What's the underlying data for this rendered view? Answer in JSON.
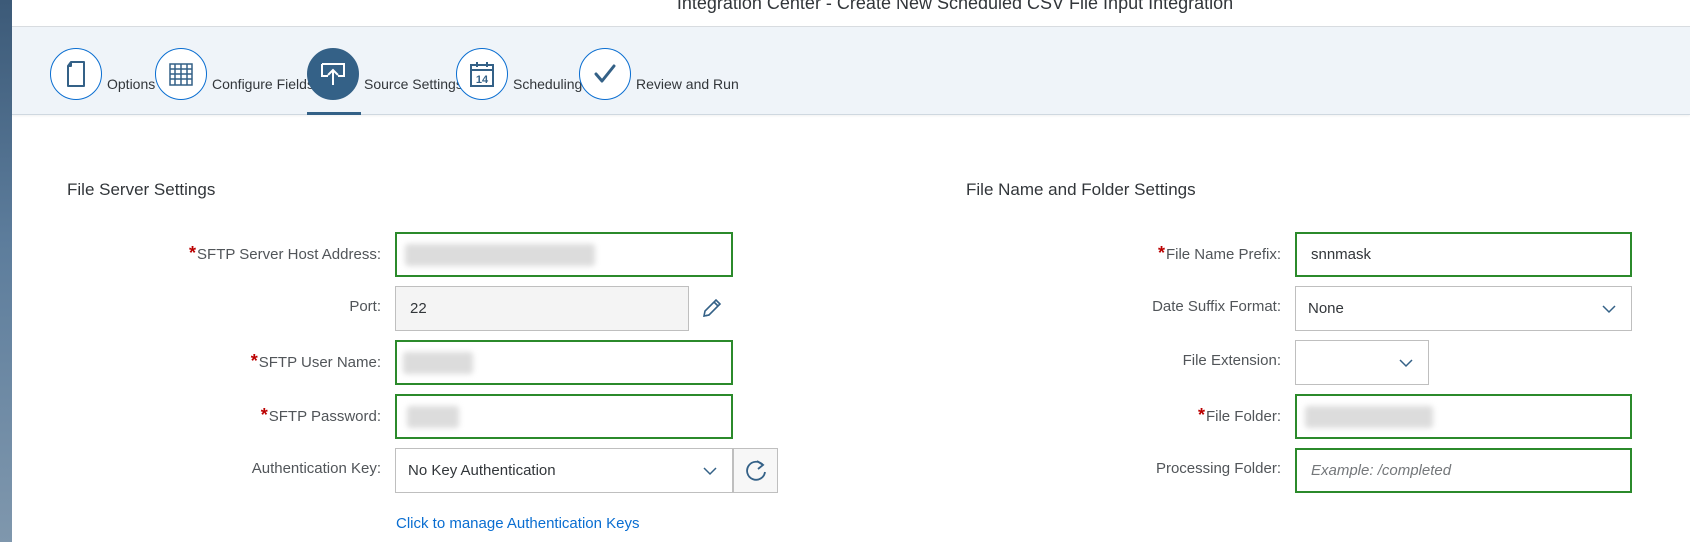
{
  "page": {
    "title": "Integration Center - Create New Scheduled CSV File Input Integration"
  },
  "wizard": {
    "steps": [
      {
        "label": "Options",
        "icon": "document-icon",
        "active": false
      },
      {
        "label": "Configure Fields",
        "icon": "grid-icon",
        "active": false
      },
      {
        "label": "Source Settings",
        "icon": "upload-icon",
        "active": true
      },
      {
        "label": "Scheduling",
        "icon": "calendar-icon",
        "active": false,
        "calendar_day": "14"
      },
      {
        "label": "Review and Run",
        "icon": "checkmark-icon",
        "active": false
      }
    ]
  },
  "file_server": {
    "title": "File Server Settings",
    "host": {
      "label": "SFTP Server Host Address:",
      "required": "*",
      "value": ""
    },
    "port": {
      "label": "Port:",
      "value": "22"
    },
    "user": {
      "label": "SFTP User Name:",
      "required": "*",
      "value": ""
    },
    "password": {
      "label": "SFTP Password:",
      "required": "*",
      "value": ""
    },
    "auth_key": {
      "label": "Authentication Key:",
      "value": "No Key Authentication"
    },
    "manage_link": "Click to manage Authentication Keys"
  },
  "file_name": {
    "title": "File Name and Folder Settings",
    "prefix": {
      "label": "File Name Prefix:",
      "required": "*",
      "value": "snnmask"
    },
    "date_suffix": {
      "label": "Date Suffix Format:",
      "value": "None"
    },
    "extension": {
      "label": "File Extension:",
      "value": ""
    },
    "folder": {
      "label": "File Folder:",
      "required": "*",
      "value": ""
    },
    "processing": {
      "label": "Processing Folder:",
      "placeholder": "Example: /completed"
    }
  },
  "colors": {
    "accent": "#0a6ed1",
    "active_step": "#346187",
    "valid_border": "#2b8a2b",
    "required": "#bb0000"
  }
}
